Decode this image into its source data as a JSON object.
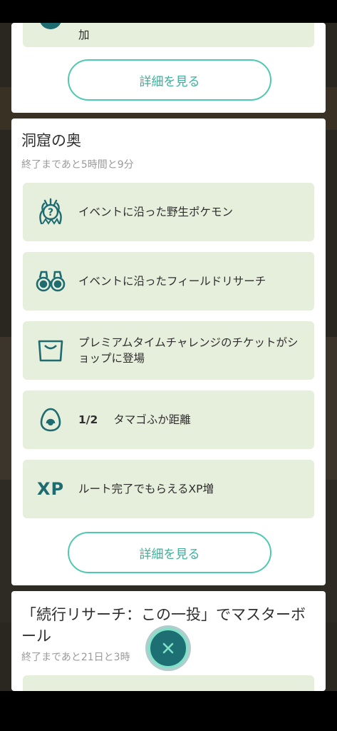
{
  "top_card": {
    "partial_text": "加",
    "details_button": "詳細を見る"
  },
  "event_card": {
    "title": "洞窟の奥",
    "subtitle": "終了まであと5時間と9分",
    "features": [
      {
        "icon": "mystery-pokemon-icon",
        "label": "イベントに沿った野生ポケモン"
      },
      {
        "icon": "binoculars-icon",
        "label": "イベントに沿ったフィールドリサーチ"
      },
      {
        "icon": "shopping-bag-icon",
        "label": "プレミアムタイムチャレンジのチケットがショップに登場"
      },
      {
        "icon": "egg-icon",
        "fraction": "1/2",
        "label": "タマゴふか距離"
      },
      {
        "icon": "xp-icon",
        "icon_text": "XP",
        "label": "ルート完了でもらえるXP増"
      }
    ],
    "details_button": "詳細を見る"
  },
  "next_card": {
    "title": "「続行リサーチ：この一投」でマスターボール",
    "subtitle": "終了まであと21日と3時"
  },
  "colors": {
    "accent": "#4ec9b0",
    "feature_bg": "#e6eedc",
    "icon_teal": "#1e6b70"
  }
}
